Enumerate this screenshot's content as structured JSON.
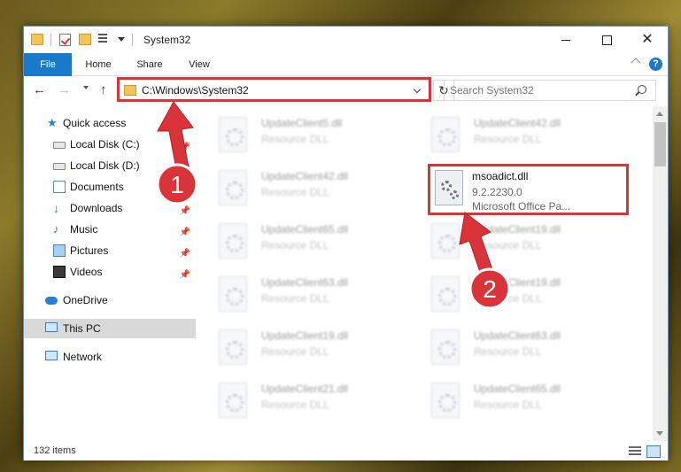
{
  "window": {
    "title": "System32",
    "buttons": {
      "minimize": "",
      "maximize": "",
      "close": "✕"
    }
  },
  "ribbon": {
    "tabs": [
      "File",
      "Home",
      "Share",
      "View"
    ],
    "help": "?"
  },
  "navbar": {
    "back": "←",
    "forward": "→",
    "up": "↑",
    "address": "C:\\Windows\\System32",
    "refresh": "↻",
    "search_placeholder": "Search System32"
  },
  "sidebar": {
    "items": [
      {
        "label": "Quick access",
        "icon": "star-icon",
        "pinned": false
      },
      {
        "label": "Local Disk (C:)",
        "icon": "disk-icon",
        "pinned": true
      },
      {
        "label": "Local Disk (D:)",
        "icon": "disk-icon",
        "pinned": true
      },
      {
        "label": "Documents",
        "icon": "document-icon",
        "pinned": true
      },
      {
        "label": "Downloads",
        "icon": "download-icon",
        "pinned": true
      },
      {
        "label": "Music",
        "icon": "music-icon",
        "pinned": true
      },
      {
        "label": "Pictures",
        "icon": "pictures-icon",
        "pinned": true
      },
      {
        "label": "Videos",
        "icon": "videos-icon",
        "pinned": true
      },
      {
        "label": "OneDrive",
        "icon": "cloud-icon",
        "pinned": false
      },
      {
        "label": "This PC",
        "icon": "computer-icon",
        "pinned": false,
        "selected": true
      },
      {
        "label": "Network",
        "icon": "network-icon",
        "pinned": false
      }
    ]
  },
  "files": {
    "left_column": [
      {
        "name": "UpdateClient5.dll",
        "desc": "Resource DLL"
      },
      {
        "name": "UpdateClient42.dll",
        "desc": "Resource DLL"
      },
      {
        "name": "UpdateClient65.dll",
        "desc": "Resource DLL"
      },
      {
        "name": "UpdateClient63.dll",
        "desc": "Resource DLL"
      },
      {
        "name": "UpdateClient19.dll",
        "desc": "Resource DLL"
      },
      {
        "name": "UpdateClient21.dll",
        "desc": "Resource DLL"
      }
    ],
    "right_column": [
      {
        "name": "UpdateClient42.dll",
        "desc": "Resource DLL"
      },
      {
        "name": "UpdateClient19.dll",
        "desc": "Resource DLL"
      },
      {
        "name": "UpdateClient19.dll",
        "desc": "Resource DLL"
      },
      {
        "name": "UpdateClient63.dll",
        "desc": "Resource DLL"
      },
      {
        "name": "UpdateClient65.dll",
        "desc": "Resource DLL"
      }
    ],
    "focused": {
      "name": "msoadict.dll",
      "version": "9.2.2230.0",
      "description": "Microsoft Office Pa..."
    }
  },
  "status": {
    "count": "132 items"
  },
  "annotations": {
    "badge1": "1",
    "badge2": "2",
    "color": "#d9343a"
  }
}
